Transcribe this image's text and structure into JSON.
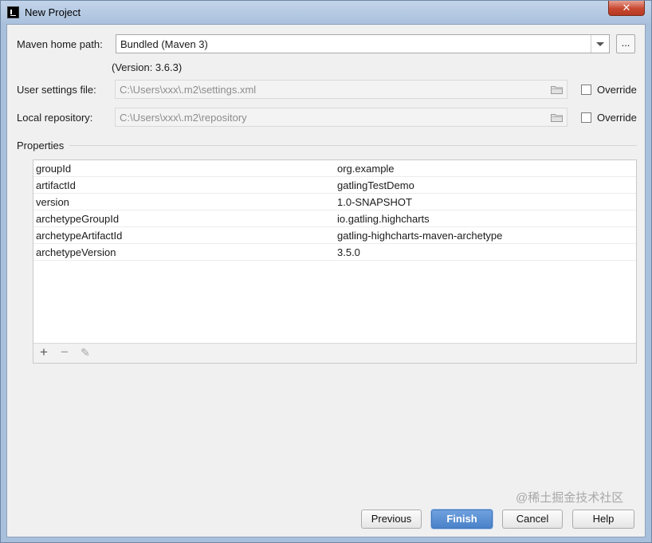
{
  "window": {
    "title": "New Project",
    "close_label": "✕"
  },
  "form": {
    "maven_home_label": "Maven home path:",
    "maven_home_value": "Bundled (Maven 3)",
    "dots_label": "...",
    "version_note": "(Version: 3.6.3)",
    "user_settings_label": "User settings file:",
    "user_settings_value": "C:\\Users\\xxx\\.m2\\settings.xml",
    "local_repo_label": "Local repository:",
    "local_repo_value": "C:\\Users\\xxx\\.m2\\repository",
    "override_label": "Override",
    "override_label_2": "Override"
  },
  "properties": {
    "section_title": "Properties",
    "rows": [
      {
        "key": "groupId",
        "value": "org.example"
      },
      {
        "key": "artifactId",
        "value": "gatlingTestDemo"
      },
      {
        "key": "version",
        "value": "1.0-SNAPSHOT"
      },
      {
        "key": "archetypeGroupId",
        "value": "io.gatling.highcharts"
      },
      {
        "key": "archetypeArtifactId",
        "value": "gatling-highcharts-maven-archetype"
      },
      {
        "key": "archetypeVersion",
        "value": "3.5.0"
      }
    ],
    "toolbar": {
      "add_glyph": "+",
      "remove_glyph": "−",
      "edit_glyph": "✎"
    }
  },
  "buttons": {
    "previous": "Previous",
    "finish": "Finish",
    "cancel": "Cancel",
    "help": "Help"
  },
  "watermark": "@稀土掘金技术社区",
  "icons": {
    "folder": "folder-icon",
    "combo_arrow": "chevron-down-icon",
    "add": "plus-icon",
    "remove": "minus-icon",
    "edit": "pencil-icon"
  },
  "colors": {
    "accent": "#4a82c9",
    "close": "#c7472f"
  }
}
